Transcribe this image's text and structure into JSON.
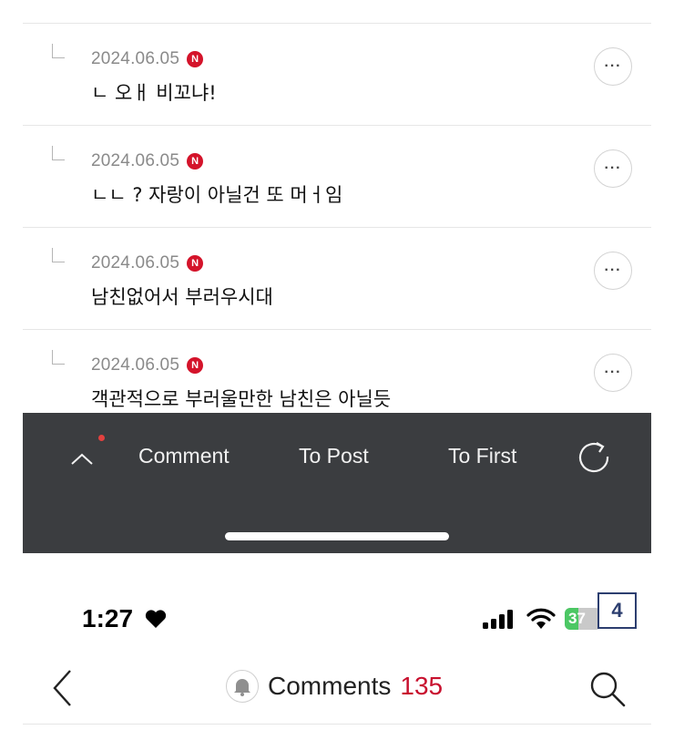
{
  "comments": [
    {
      "date": "2024.06.05",
      "badge": "N",
      "text": "ㄴ 오ㅐ 비꼬냐!"
    },
    {
      "date": "2024.06.05",
      "badge": "N",
      "text": "ㄴㄴ ? 자랑이 아닐건 또 머ㅓ임"
    },
    {
      "date": "2024.06.05",
      "badge": "N",
      "text": "남친없어서 부러우시대"
    },
    {
      "date": "2024.06.05",
      "badge": "N",
      "text": "객관적으로 부러울만한 남친은 아닐듯"
    }
  ],
  "comment_more_label": "···",
  "toolbar": {
    "comment_label": "Comment",
    "to_post_label": "To Post",
    "to_first_label": "To First",
    "up_icon": "chevron-up-icon",
    "refresh_icon": "refresh-icon",
    "notification_dot_color": "#e3413f",
    "background_color": "#3b3d40"
  },
  "status_bar": {
    "time": "1:27",
    "battery_level": "37",
    "battery_fraction": 0.37,
    "overlay_badge": "4"
  },
  "nav": {
    "title": "Comments",
    "count": "135",
    "count_color": "#c8102e"
  }
}
